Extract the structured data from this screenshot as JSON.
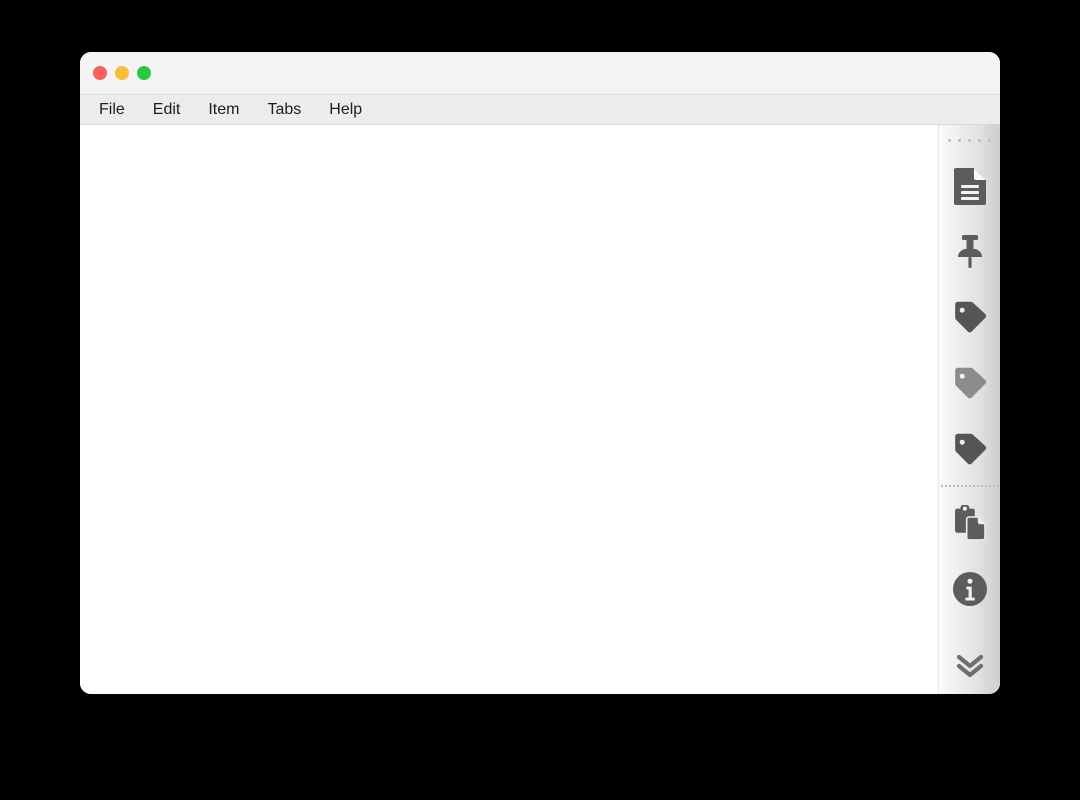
{
  "window": {
    "title": "",
    "traffic_lights": [
      {
        "name": "close",
        "color": "#f9615c",
        "label": "Close"
      },
      {
        "name": "minimize",
        "color": "#fbbd37",
        "label": "Minimize"
      },
      {
        "name": "zoom",
        "color": "#2bc93f",
        "label": "Zoom"
      }
    ]
  },
  "menubar": {
    "items": [
      {
        "label": "File"
      },
      {
        "label": "Edit"
      },
      {
        "label": "Item"
      },
      {
        "label": "Tabs"
      },
      {
        "label": "Help"
      }
    ]
  },
  "content": {
    "text": ""
  },
  "sidebar": {
    "drag_handle": {
      "icon": "drag-dots-icon",
      "dot_count": 5,
      "color": "#bdbdbd"
    },
    "items": [
      {
        "icon": "document-icon",
        "label": "Document",
        "color": "#5c5c5c"
      },
      {
        "icon": "pin-icon",
        "label": "Pin",
        "color": "#5c5c5c"
      },
      {
        "icon": "tag-icon",
        "label": "Tag 1",
        "color": "#555555"
      },
      {
        "icon": "tag-icon",
        "label": "Tag 2",
        "color": "#8c8c8c"
      },
      {
        "icon": "tag-icon",
        "label": "Tag 3",
        "color": "#555555"
      }
    ],
    "divider": {
      "style": "dotted",
      "color": "#bcbcbc"
    },
    "items_lower": [
      {
        "icon": "clipboard-copy-icon",
        "label": "Copy",
        "color": "#5c5c5c"
      },
      {
        "icon": "info-circle-icon",
        "label": "Info",
        "color": "#5c5c5c"
      }
    ],
    "bottom": {
      "icon": "chevron-double-down-icon",
      "label": "More",
      "color": "#6e6e6e"
    }
  }
}
